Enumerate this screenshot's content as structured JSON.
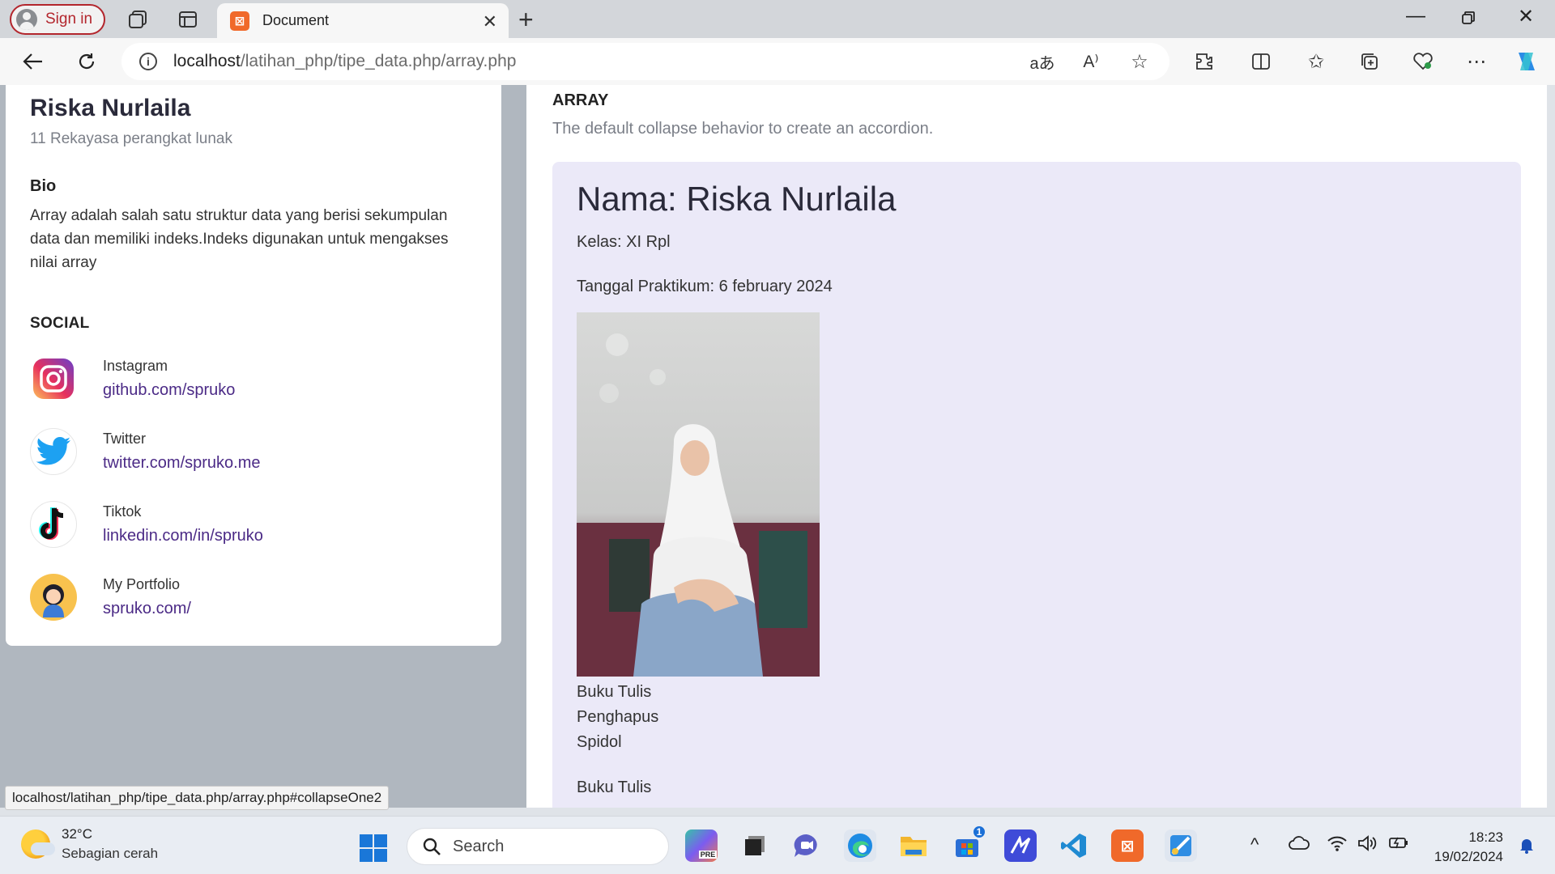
{
  "browser": {
    "signin_label": "Sign in",
    "tab_title": "Document",
    "tab_favicon": "xampp-icon",
    "url_host": "localhost",
    "url_path": "/latihan_php/tipe_data.php/array.php",
    "status_url": "localhost/latihan_php/tipe_data.php/array.php#collapseOne2"
  },
  "profile": {
    "name": "Riska Nurlaila",
    "class": "11 Rekayasa perangkat lunak",
    "bio_heading": "Bio",
    "bio_text": "Array adalah salah satu struktur data yang berisi sekumpulan data dan memiliki indeks.Indeks digunakan untuk mengakses nilai array",
    "social_heading": "SOCIAL",
    "social": [
      {
        "name": "Instagram",
        "link": "github.com/spruko",
        "icon": "instagram-icon"
      },
      {
        "name": "Twitter",
        "link": "twitter.com/spruko.me",
        "icon": "twitter-icon"
      },
      {
        "name": "Tiktok",
        "link": "linkedin.com/in/spruko",
        "icon": "tiktok-icon"
      },
      {
        "name": "My Portfolio",
        "link": "spruko.com/",
        "icon": "portfolio-avatar-icon"
      }
    ]
  },
  "main": {
    "heading": "ARRAY",
    "subheading": "The default collapse behavior to create an accordion.",
    "accordion": {
      "title": "Nama: Riska Nurlaila",
      "kelas": "Kelas: XI Rpl",
      "tanggal": "Tanggal Praktikum: 6 february 2024",
      "items": [
        "Buku Tulis",
        "Penghapus",
        "Spidol"
      ],
      "after_item": "Buku Tulis"
    }
  },
  "taskbar": {
    "temperature": "32°C",
    "weather": "Sebagian cerah",
    "search_label": "Search",
    "time": "18:23",
    "date": "19/02/2024",
    "store_badge": "1",
    "pre_badge": "PRE"
  },
  "colors": {
    "accent_purple": "#4b2a86",
    "accordion_bg": "#ebe9f8",
    "signin_red": "#b3262d"
  }
}
